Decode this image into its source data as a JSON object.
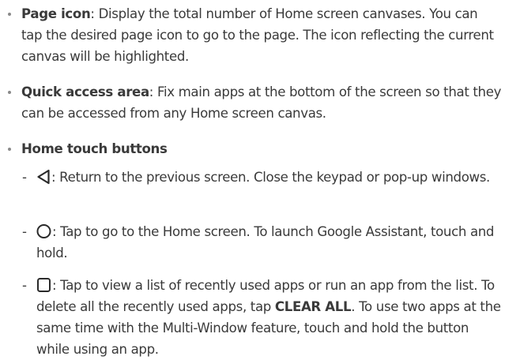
{
  "items": [
    {
      "title": "Page icon",
      "text": ": Display the total number of Home screen canvases. You can tap the desired page icon to go to the page. The icon reflecting the current canvas will be highlighted."
    },
    {
      "title": "Quick access area",
      "text": ": Fix main apps at the bottom of the screen so that they can be accessed from any Home screen canvas."
    },
    {
      "title": "Home touch buttons"
    }
  ],
  "buttons": [
    {
      "icon": "back-triangle-icon",
      "dash": "-",
      "text": ": Return to the previous screen. Close the keypad or pop-up windows."
    },
    {
      "icon": "home-circle-icon",
      "dash": "-",
      "text": ": Tap to go to the Home screen. To launch Google Assistant, touch and hold."
    },
    {
      "icon": "recents-square-icon",
      "dash": "-",
      "text_before": ": Tap to view a list of recently used apps or run an app from the list. To delete all the recently used apps, tap ",
      "bold": "CLEAR ALL",
      "text_after": ". To use two apps at the same time with the Multi-Window feature, touch and hold the button while using an app."
    }
  ]
}
